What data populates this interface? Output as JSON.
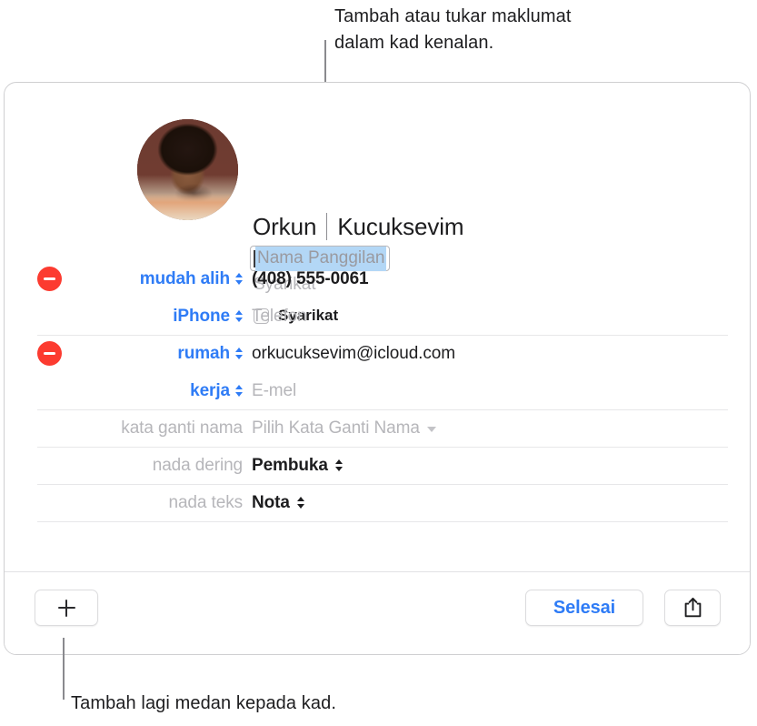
{
  "callouts": {
    "top": "Tambah atau tukar maklumat\ndalam kad kenalan.",
    "bottom": "Tambah lagi medan kepada kad."
  },
  "card": {
    "avatar_alt": "contact-photo",
    "name": {
      "first": "Orkun",
      "last": "Kucuksevim"
    },
    "nickname_placeholder": "Nama Panggilan",
    "company_placeholder": "Syarikat",
    "company_checkbox_label": "Syarikat",
    "fields": [
      {
        "label": "mudah alih",
        "value": "(408) 555-0061",
        "label_style": "blue",
        "value_style": "bold",
        "has_remove": true,
        "stepper": "updown"
      },
      {
        "label": "iPhone",
        "value": "Telefon",
        "label_style": "blue",
        "value_style": "placeholder",
        "has_remove": false,
        "stepper": "updown"
      },
      {
        "label": "rumah",
        "value": "orkucuksevim@icloud.com",
        "label_style": "blue",
        "value_style": "normal",
        "has_remove": true,
        "stepper": "updown"
      },
      {
        "label": "kerja",
        "value": "E-mel",
        "label_style": "blue",
        "value_style": "placeholder",
        "has_remove": false,
        "stepper": "updown"
      },
      {
        "label": "kata ganti nama",
        "value": "Pilih Kata Ganti Nama",
        "label_style": "gray",
        "value_style": "placeholder",
        "has_remove": false,
        "stepper": "chevron"
      },
      {
        "label": "nada dering",
        "value": "Pembuka",
        "label_style": "gray",
        "value_style": "bold",
        "has_remove": false,
        "stepper": "updown-dark"
      },
      {
        "label": "nada teks",
        "value": "Nota",
        "label_style": "gray",
        "value_style": "bold",
        "has_remove": false,
        "stepper": "updown-dark"
      }
    ],
    "toolbar": {
      "add_field_icon": "plus-icon",
      "done_label": "Selesai",
      "share_icon": "share-icon"
    }
  },
  "colors": {
    "accent_blue": "#2f7cf6",
    "remove_red": "#fc3b30",
    "placeholder_gray": "#b6b6ba",
    "selection_blue": "#b3d7f6",
    "rule_gray": "#e7e7e9"
  }
}
